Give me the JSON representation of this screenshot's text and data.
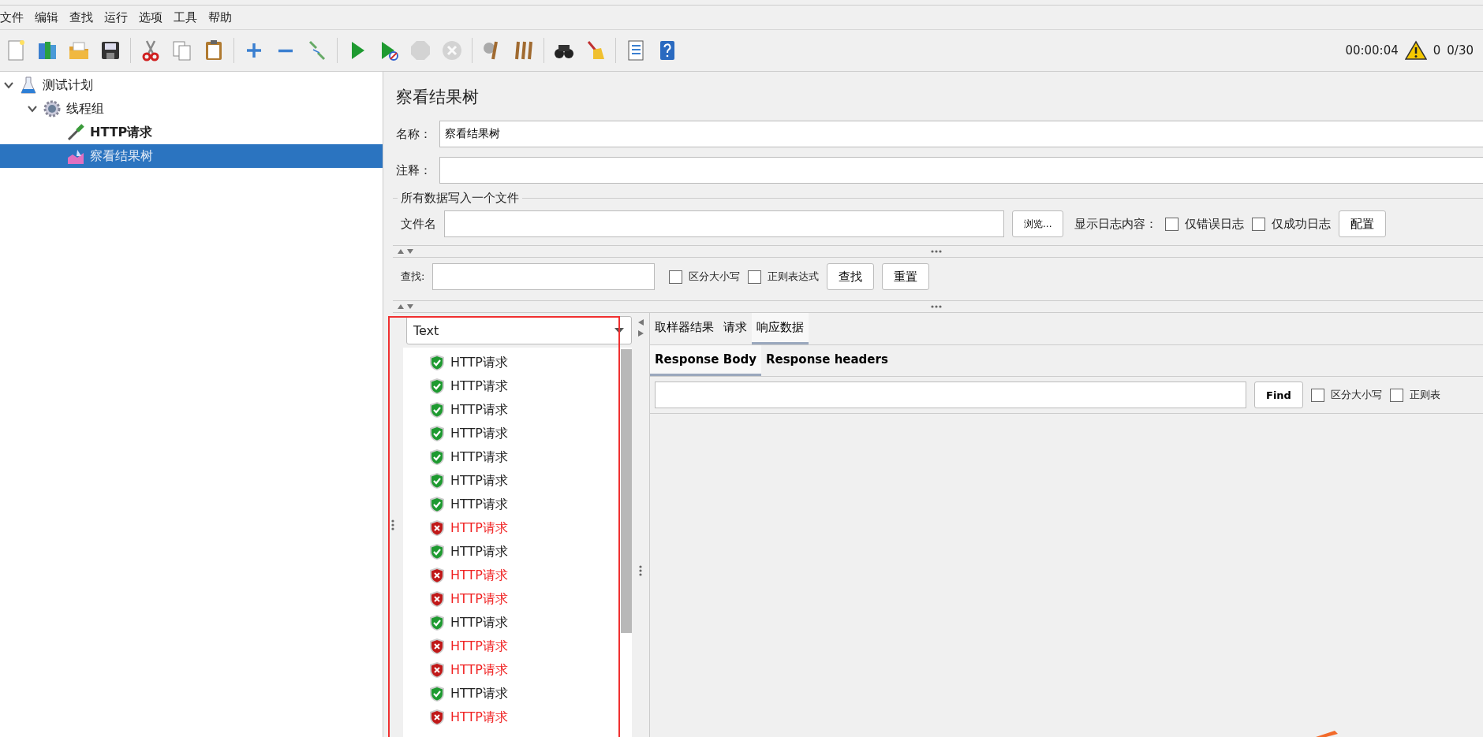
{
  "menu": [
    "文件",
    "编辑",
    "查找",
    "运行",
    "选项",
    "工具",
    "帮助"
  ],
  "toolbar": [
    {
      "kind": "new",
      "disabled": false
    },
    {
      "kind": "templates",
      "disabled": false
    },
    {
      "kind": "open",
      "disabled": false
    },
    {
      "kind": "save",
      "disabled": false
    },
    {
      "kind": "sep"
    },
    {
      "kind": "cut",
      "disabled": false
    },
    {
      "kind": "copy",
      "disabled": false
    },
    {
      "kind": "paste",
      "disabled": false
    },
    {
      "kind": "sep"
    },
    {
      "kind": "expand",
      "disabled": false
    },
    {
      "kind": "collapse",
      "disabled": false
    },
    {
      "kind": "toggle",
      "disabled": false
    },
    {
      "kind": "sep"
    },
    {
      "kind": "start",
      "disabled": false
    },
    {
      "kind": "start-no-pause",
      "disabled": false
    },
    {
      "kind": "stop",
      "disabled": true
    },
    {
      "kind": "shutdown",
      "disabled": true
    },
    {
      "kind": "sep"
    },
    {
      "kind": "clear",
      "disabled": false
    },
    {
      "kind": "clear-all",
      "disabled": false
    },
    {
      "kind": "sep"
    },
    {
      "kind": "search",
      "disabled": false
    },
    {
      "kind": "reset-search",
      "disabled": false
    },
    {
      "kind": "sep"
    },
    {
      "kind": "function-helper",
      "disabled": false
    },
    {
      "kind": "help",
      "disabled": false
    }
  ],
  "status": {
    "elapsed": "00:00:04",
    "warnings": "0",
    "threads": "0/30"
  },
  "tree": [
    {
      "label": "测试计划",
      "kind": "plan",
      "expanded": true,
      "selected": false,
      "children": [
        {
          "label": "线程组",
          "kind": "thread-group",
          "expanded": true,
          "selected": false,
          "children": [
            {
              "label": "HTTP请求",
              "kind": "sampler",
              "selected": false
            },
            {
              "label": "察看结果树",
              "kind": "listener",
              "selected": true
            }
          ]
        }
      ]
    }
  ],
  "panel": {
    "title": "察看结果树",
    "name_label": "名称：",
    "name_value": "察看结果树",
    "comment_label": "注释：",
    "file_group": "所有数据写入一个文件",
    "file_label": "文件名",
    "browse": "浏览...",
    "log_label": "显示日志内容：",
    "log_options": [
      {
        "label": "仅错误日志",
        "checked": false
      },
      {
        "label": "仅成功日志",
        "checked": false
      }
    ],
    "configure": "配置",
    "search_label": "查找:",
    "search_options": [
      {
        "label": "区分大小写",
        "checked": false
      },
      {
        "label": "正则表达式",
        "checked": false
      }
    ],
    "search_button": "查找",
    "reset_button": "重置"
  },
  "results": {
    "renderer": "Text",
    "items": [
      {
        "label": "HTTP请求",
        "success": true
      },
      {
        "label": "HTTP请求",
        "success": true
      },
      {
        "label": "HTTP请求",
        "success": true
      },
      {
        "label": "HTTP请求",
        "success": true
      },
      {
        "label": "HTTP请求",
        "success": true
      },
      {
        "label": "HTTP请求",
        "success": true
      },
      {
        "label": "HTTP请求",
        "success": true
      },
      {
        "label": "HTTP请求",
        "success": false
      },
      {
        "label": "HTTP请求",
        "success": true
      },
      {
        "label": "HTTP请求",
        "success": false
      },
      {
        "label": "HTTP请求",
        "success": false
      },
      {
        "label": "HTTP请求",
        "success": true
      },
      {
        "label": "HTTP请求",
        "success": false
      },
      {
        "label": "HTTP请求",
        "success": false
      },
      {
        "label": "HTTP请求",
        "success": true
      },
      {
        "label": "HTTP请求",
        "success": false
      }
    ]
  },
  "detail_tabs": [
    {
      "label": "取样器结果",
      "selected": false
    },
    {
      "label": "请求",
      "selected": false
    },
    {
      "label": "响应数据",
      "selected": true
    }
  ],
  "response_tabs": [
    {
      "label": "Response Body",
      "selected": true
    },
    {
      "label": "Response headers",
      "selected": false
    }
  ],
  "response_search": {
    "button": "Find",
    "options": [
      {
        "label": "区分大小写",
        "checked": false
      },
      {
        "label": "正则表",
        "checked": false
      }
    ]
  }
}
